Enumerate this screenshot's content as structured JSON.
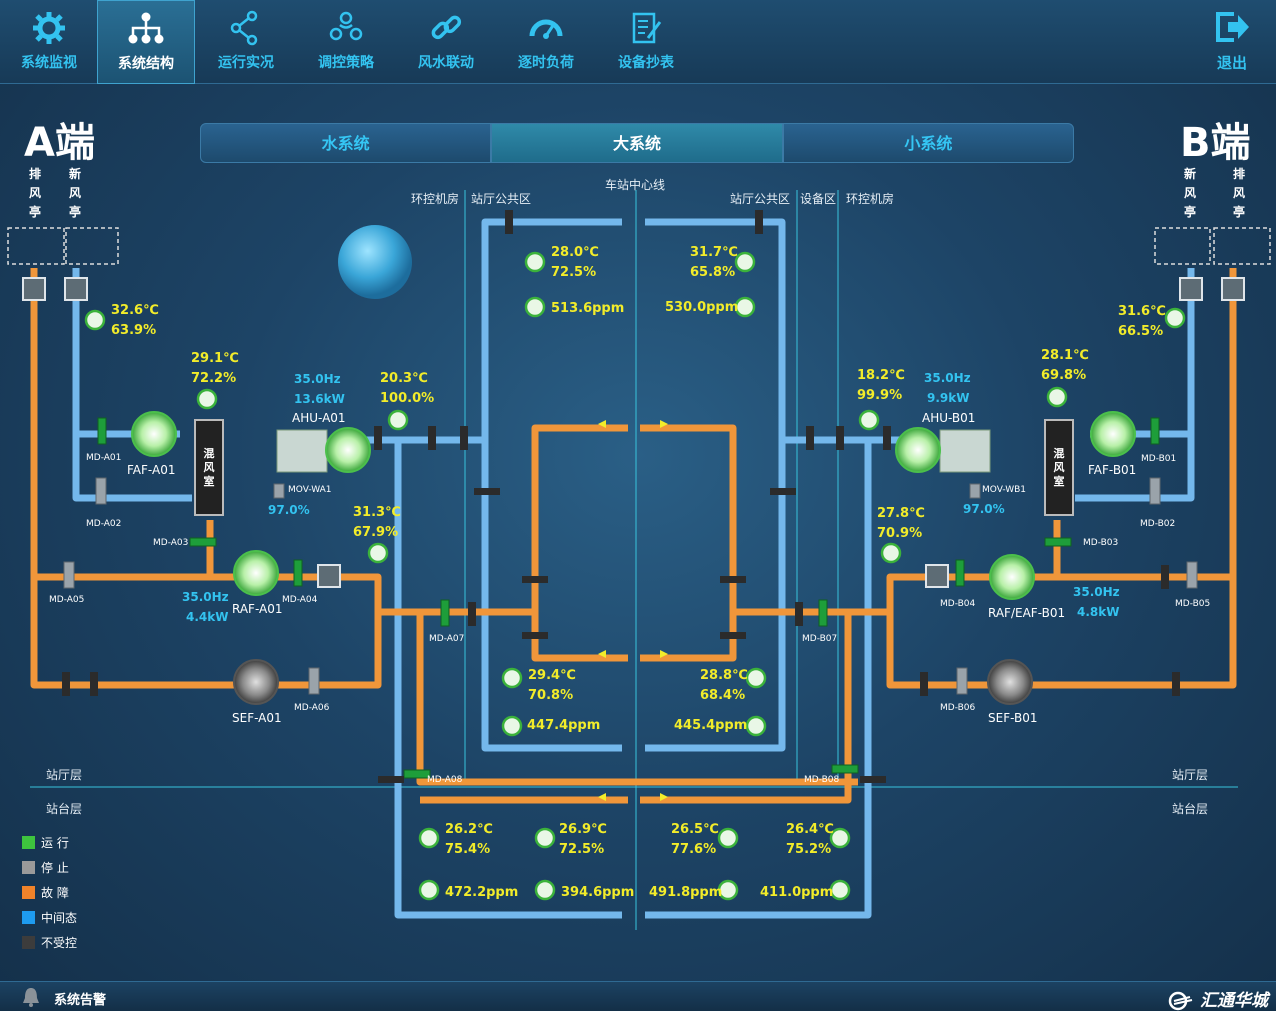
{
  "nav": [
    {
      "label": "系统监视",
      "icon": "gear-icon"
    },
    {
      "label": "系统结构",
      "icon": "org-chart-icon",
      "active": true
    },
    {
      "label": "运行实况",
      "icon": "share-nodes-icon"
    },
    {
      "label": "调控策略",
      "icon": "people-group-icon"
    },
    {
      "label": "风水联动",
      "icon": "chain-link-icon"
    },
    {
      "label": "逐时负荷",
      "icon": "gauge-icon"
    },
    {
      "label": "设备抄表",
      "icon": "clipboard-pen-icon"
    }
  ],
  "logout_label": "退出",
  "end_a": "A端",
  "end_b": "B端",
  "tabs": [
    {
      "label": "水系统"
    },
    {
      "label": "大系统",
      "active": true
    },
    {
      "label": "小系统"
    }
  ],
  "kiosk_labels": {
    "a_exhaust": "排风亭",
    "a_fresh": "新风亭",
    "b_fresh": "新风亭",
    "b_exhaust": "排风亭"
  },
  "zones": {
    "a_ring": "环控机房",
    "a_hall": "站厅公共区",
    "center": "车站中心线",
    "b_hall": "站厅公共区",
    "b_equip": "设备区",
    "b_ring": "环控机房",
    "hall_level_a": "站厅层",
    "platform_level_a": "站台层",
    "hall_level_b": "站厅层",
    "platform_level_b": "站台层"
  },
  "sensors": {
    "a_fresh": {
      "t": "32.6℃",
      "h": "63.9%"
    },
    "a_mix": {
      "t": "29.1℃",
      "h": "72.2%"
    },
    "a_supply": {
      "t": "20.3℃",
      "h": "100.0%"
    },
    "a_return": {
      "t": "31.3℃",
      "h": "67.9%"
    },
    "hall_tl": {
      "t": "28.0℃",
      "h": "72.5%",
      "co2": "513.6ppm"
    },
    "hall_tr": {
      "t": "31.7℃",
      "h": "65.8%",
      "co2": "530.0ppm"
    },
    "hall_bl": {
      "t": "29.4℃",
      "h": "70.8%",
      "co2": "447.4ppm"
    },
    "hall_br": {
      "t": "28.8℃",
      "h": "68.4%",
      "co2": "445.4ppm"
    },
    "b_fresh": {
      "t": "31.6℃",
      "h": "66.5%"
    },
    "b_mix": {
      "t": "28.1℃",
      "h": "69.8%"
    },
    "b_supply": {
      "t": "18.2℃",
      "h": "99.9%"
    },
    "b_return": {
      "t": "27.8℃",
      "h": "70.9%"
    },
    "plat_1": {
      "t": "26.2℃",
      "h": "75.4%",
      "co2": "472.2ppm"
    },
    "plat_2": {
      "t": "26.9℃",
      "h": "72.5%",
      "co2": "394.6ppm"
    },
    "plat_3": {
      "t": "26.5℃",
      "h": "77.6%",
      "co2": "491.8ppm"
    },
    "plat_4": {
      "t": "26.4℃",
      "h": "75.2%",
      "co2": "411.0ppm"
    }
  },
  "ahu_a": {
    "name": "AHU-A01",
    "freq": "35.0Hz",
    "power": "13.6kW",
    "valve": "MOV-WA1",
    "valve_open": "97.0%"
  },
  "ahu_b": {
    "name": "AHU-B01",
    "freq": "35.0Hz",
    "power": "9.9kW",
    "valve": "MOV-WB1",
    "valve_open": "97.0%"
  },
  "raf_a": {
    "name": "RAF-A01",
    "freq": "35.0Hz",
    "power": "4.4kW"
  },
  "raf_b": {
    "name": "RAF/EAF-B01",
    "freq": "35.0Hz",
    "power": "4.8kW"
  },
  "fans": {
    "faf_a": "FAF-A01",
    "faf_b": "FAF-B01",
    "sef_a": "SEF-A01",
    "sef_b": "SEF-B01"
  },
  "mix_room": "混风室",
  "dampers": {
    "a01": "MD-A01",
    "a02": "MD-A02",
    "a03": "MD-A03",
    "a04": "MD-A04",
    "a05": "MD-A05",
    "a06": "MD-A06",
    "a07": "MD-A07",
    "a08": "MD-A08",
    "b01": "MD-B01",
    "b02": "MD-B02",
    "b03": "MD-B03",
    "b04": "MD-B04",
    "b05": "MD-B05",
    "b06": "MD-B06",
    "b07": "MD-B07",
    "b08": "MD-B08"
  },
  "legend": [
    {
      "label": "运  行",
      "color": "#3ec43e"
    },
    {
      "label": "停  止",
      "color": "#9a9a9a"
    },
    {
      "label": "故  障",
      "color": "#f0832a"
    },
    {
      "label": "中间态",
      "color": "#1e9bef"
    },
    {
      "label": "不受控",
      "color": "#3c3c3c"
    }
  ],
  "alarm_label": "系统告警",
  "brand": "汇通华城",
  "colors": {
    "supply_pipe": "#74b8ec",
    "return_pipe": "#f0963a",
    "value_yellow": "#f2ec2a",
    "value_cyan": "#33c3f0"
  }
}
